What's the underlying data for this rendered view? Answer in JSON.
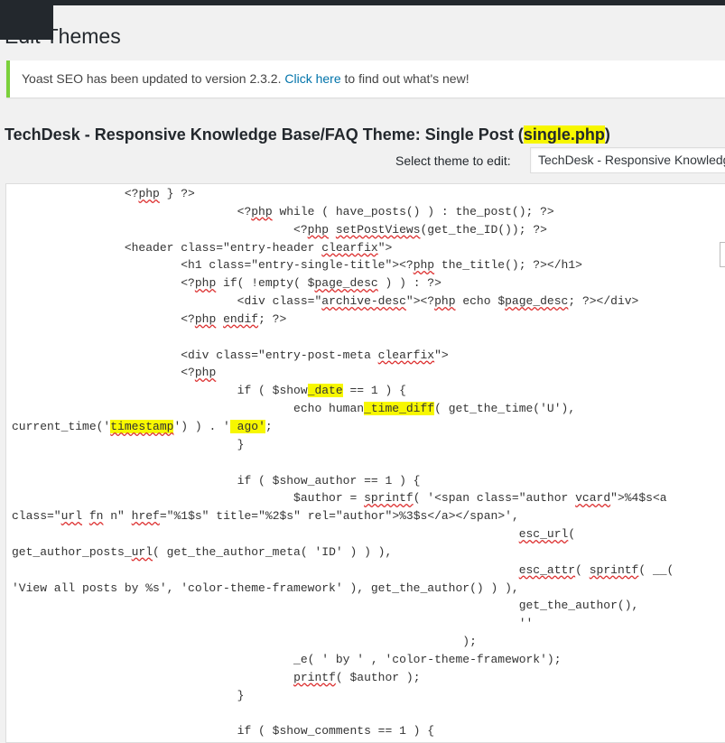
{
  "page": {
    "title": "Edit Themes"
  },
  "notice": {
    "prefix": "Yoast SEO has been updated to version 2.3.2.",
    "link": "Click here",
    "suffix": "to find out what's new!"
  },
  "file_header": {
    "title_before": "TechDesk - Responsive Knowledge Base/FAQ Theme: Single Post (",
    "file_name": "single.php",
    "title_after": ")"
  },
  "theme_selector": {
    "label": "Select theme to edit:",
    "selected": "TechDesk - Responsive Knowledge Base/FAQ Theme"
  },
  "editor": {
    "lines": [
      [
        "                <?",
        {
          "t": "php",
          "c": "sq"
        },
        " } ?>"
      ],
      [
        "                                <?",
        {
          "t": "php",
          "c": "sq"
        },
        " while ( have_posts() ) : the_post(); ?>"
      ],
      [
        "                                        <?",
        {
          "t": "php",
          "c": "sq"
        },
        " ",
        {
          "t": "setPostViews",
          "c": "sq"
        },
        "(get_the_ID()); ?>"
      ],
      [
        "                <header class=\"entry-header ",
        {
          "t": "clearfix",
          "c": "sq"
        },
        "\">"
      ],
      [
        "                        <h1 class=\"entry-single-title\"><?",
        {
          "t": "php",
          "c": "sq"
        },
        " the_title(); ?></h1>"
      ],
      [
        "                        <?",
        {
          "t": "php",
          "c": "sq"
        },
        " if( !empty( $",
        {
          "t": "page_desc",
          "c": "sq"
        },
        " ) ) : ?>"
      ],
      [
        "                                <div class=\"",
        {
          "t": "archive-desc",
          "c": "sq"
        },
        "\"><?",
        {
          "t": "php",
          "c": "sq"
        },
        " echo $",
        {
          "t": "page_desc",
          "c": "sq"
        },
        "; ?></div>"
      ],
      [
        "                        <?",
        {
          "t": "php",
          "c": "sq"
        },
        " ",
        {
          "t": "endif",
          "c": "sq"
        },
        "; ?>"
      ],
      [
        ""
      ],
      [
        "                        <div class=\"entry-post-meta ",
        {
          "t": "clearfix",
          "c": "sq"
        },
        "\">"
      ],
      [
        "                        <?",
        {
          "t": "php",
          "c": "sq"
        }
      ],
      [
        "                                if ( $show",
        {
          "t": "_date",
          "c": "hl"
        },
        " == 1 ) {"
      ],
      [
        "                                        echo human",
        {
          "t": "_time_diff",
          "c": "hl"
        },
        "( get_the_time('U'),"
      ],
      [
        "current_time('",
        {
          "t": "timestamp",
          "c": "hlsq"
        },
        "') ) . '",
        {
          "t": " ago'",
          "c": "hl"
        },
        ";"
      ],
      [
        "                                }"
      ],
      [
        ""
      ],
      [
        "                                if ( $show_author == 1 ) {"
      ],
      [
        "                                        $author = ",
        {
          "t": "sprintf",
          "c": "sq"
        },
        "( '<span class=\"author ",
        {
          "t": "vcard",
          "c": "sq"
        },
        "\">%4$s<a"
      ],
      [
        "class=\"",
        {
          "t": "url",
          "c": "sq"
        },
        " ",
        {
          "t": "fn",
          "c": "sq"
        },
        " n\" ",
        {
          "t": "href",
          "c": "sq"
        },
        "=\"%1$s\" title=\"%2$s\" rel=\"author\">%3$s</a></span>',"
      ],
      [
        "                                                                        ",
        {
          "t": "esc_url",
          "c": "sq"
        },
        "("
      ],
      [
        "get_author_posts_",
        {
          "t": "url",
          "c": "sq"
        },
        "( get_the_author_meta( 'ID' ) ) ),"
      ],
      [
        "                                                                        ",
        {
          "t": "esc_attr",
          "c": "sq"
        },
        "( ",
        {
          "t": "sprintf",
          "c": "sq"
        },
        "( __("
      ],
      [
        "'View all posts by %s', 'color-theme-framework' ), get_the_author() ) ),"
      ],
      [
        "                                                                        get_the_author(),"
      ],
      [
        "                                                                        ''"
      ],
      [
        "                                                                );"
      ],
      [
        "                                        _e( ' by ' , 'color-theme-framework');"
      ],
      [
        "                                        ",
        {
          "t": "printf",
          "c": "sq"
        },
        "( $author );"
      ],
      [
        "                                }"
      ],
      [
        ""
      ],
      [
        "                                if ( $show_comments == 1 ) {"
      ]
    ]
  }
}
